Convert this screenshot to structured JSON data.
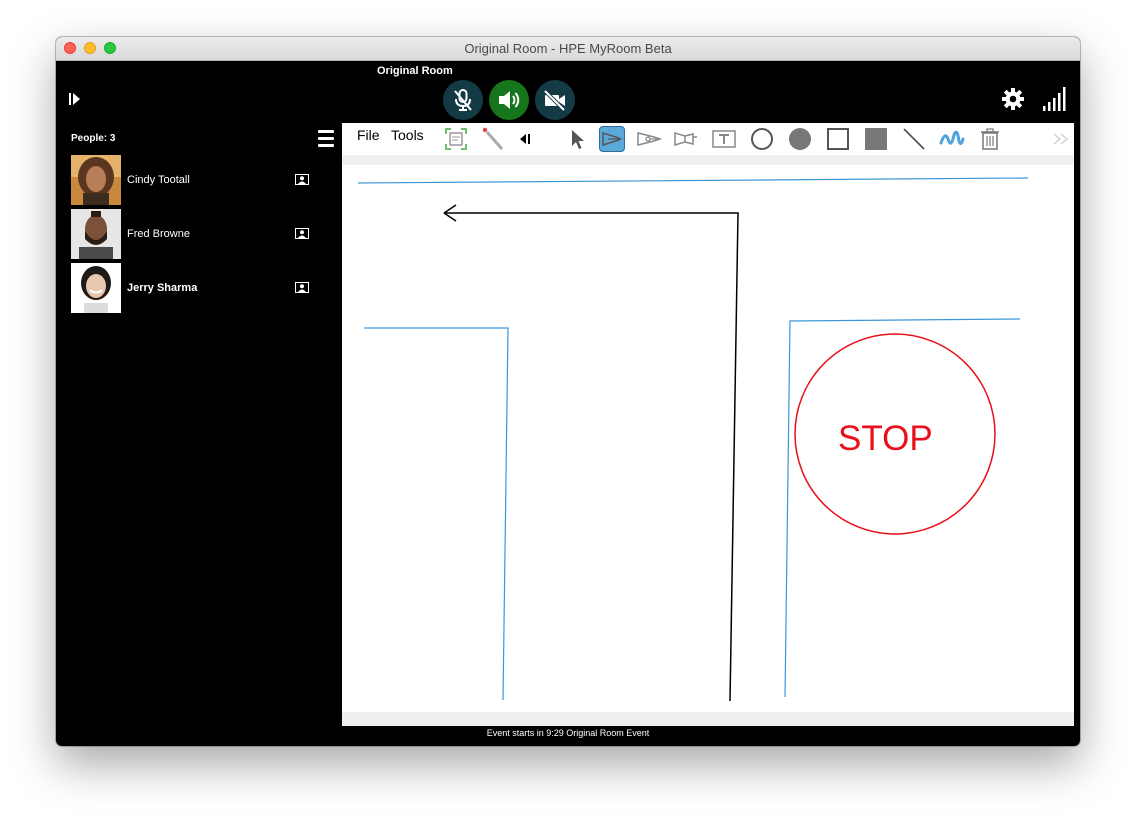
{
  "window": {
    "title": "Original Room - HPE MyRoom Beta"
  },
  "header": {
    "room_name": "Original Room",
    "mic_state": "muted",
    "speaker_state": "on",
    "camera_state": "off"
  },
  "sidebar": {
    "people_label": "People: 3",
    "people": [
      {
        "name": "Cindy Tootall",
        "bold": false
      },
      {
        "name": "Fred Browne",
        "bold": false
      },
      {
        "name": "Jerry Sharma",
        "bold": true
      }
    ]
  },
  "toolbar": {
    "menus": [
      "File",
      "Tools"
    ],
    "tools": [
      "screen-capture",
      "laser-pointer",
      "collapse",
      "select",
      "pen",
      "fountain-pen",
      "highlighter",
      "text",
      "circle-outline",
      "circle-filled",
      "rectangle-outline",
      "rectangle-filled",
      "line",
      "freehand",
      "trash"
    ],
    "active_tool": "pen"
  },
  "canvas": {
    "annotation_text": "STOP",
    "stroke_colors": {
      "blue": "#3c96d8",
      "black": "#000000",
      "red": "#e8101a"
    }
  },
  "status_bar": {
    "text": "Event starts in 9:29 Original Room Event"
  },
  "colors": {
    "speaker_active": "#17751c",
    "media_off": "#143a45",
    "active_tool": "#5aa9d8"
  }
}
